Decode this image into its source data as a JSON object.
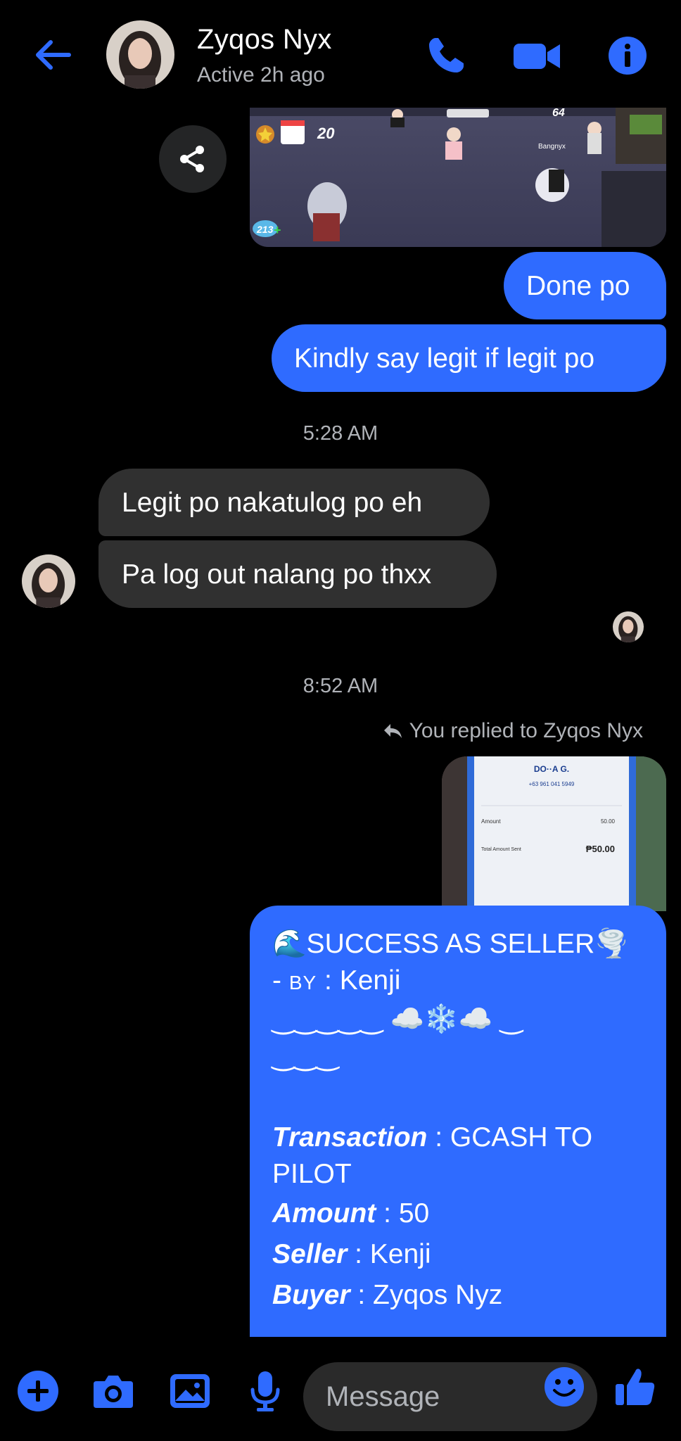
{
  "header": {
    "contact_name": "Zyqos Nyx",
    "status": "Active 2h ago"
  },
  "game_image": {
    "rank_count": "20",
    "level": "64",
    "player_tag": "Bangnyx",
    "robux": "213"
  },
  "messages": {
    "out_done": "Done po",
    "out_kindly": "Kindly say legit if legit po",
    "time_1": "5:28 AM",
    "in_legit": "Legit po nakatulog po eh",
    "in_logout": "Pa log out nalang po thxx",
    "time_2": "8:52 AM",
    "reply_note": "You replied to Zyqos Nyx"
  },
  "receipt": {
    "name": "DO··A G.",
    "number": "+63 961 041 5949",
    "amount_label": "Amount",
    "amount_value": "50.00",
    "total_label": "Total Amount Sent",
    "total_value": "₱50.00"
  },
  "seller_message": {
    "line1": "🌊SUCCESS AS SELLER🌪️",
    "line2_prefix": "- ",
    "line2_by": "BY",
    "line2_rest": " : Kenji",
    "line3": "‿‿‿‿‿ ☁️❄️☁️ ‿",
    "line4": "‿‿‿",
    "transaction_label": "Transaction",
    "transaction_value": " : GCASH TO",
    "transaction_cont": "PILOT",
    "amount_label": "Amount",
    "amount_value": " : 50",
    "seller_label": "Seller",
    "seller_value": " : Kenji",
    "buyer_label": "Buyer",
    "buyer_value": " : Zyqos Nyz"
  },
  "composer": {
    "placeholder": "Message"
  },
  "colors": {
    "accent": "#2f6bff",
    "incoming_bubble": "#303030",
    "muted_text": "#b0b3b8",
    "background": "#000000"
  }
}
